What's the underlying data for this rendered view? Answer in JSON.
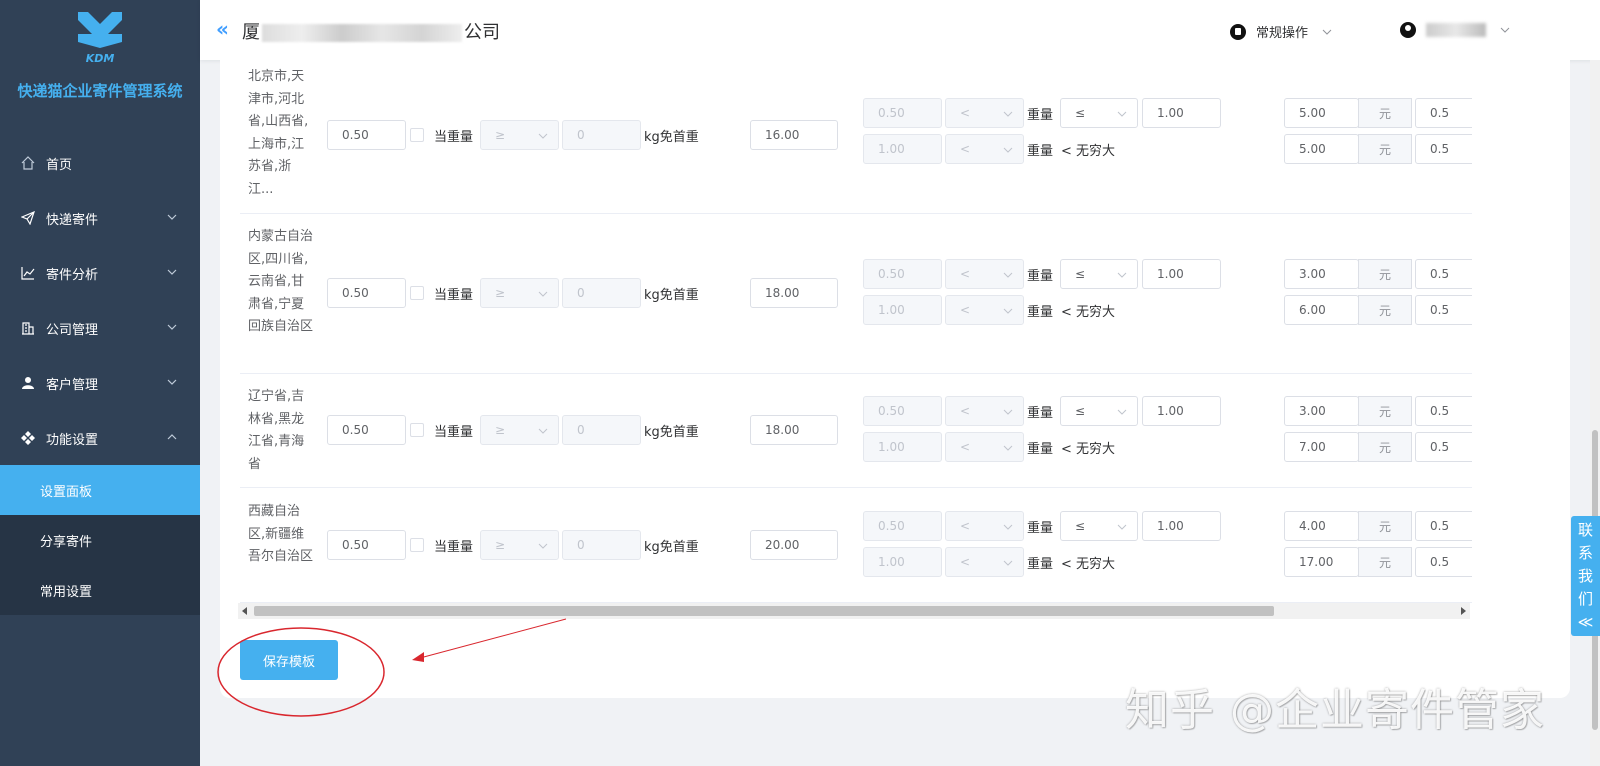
{
  "app": {
    "logo_text": "KDM",
    "title": "快递猫企业寄件管理系统"
  },
  "sidebar": {
    "items": [
      {
        "label": "首页",
        "icon": "home-icon",
        "expandable": false
      },
      {
        "label": "快递寄件",
        "icon": "paper-plane-icon",
        "expandable": true
      },
      {
        "label": "寄件分析",
        "icon": "line-chart-icon",
        "expandable": true
      },
      {
        "label": "公司管理",
        "icon": "building-icon",
        "expandable": true
      },
      {
        "label": "客户管理",
        "icon": "user-icon",
        "expandable": true
      },
      {
        "label": "功能设置",
        "icon": "diamond-icon",
        "expandable": true,
        "expanded": true
      }
    ],
    "subitems": [
      {
        "label": "设置面板",
        "active": true
      },
      {
        "label": "分享寄件",
        "active": false
      },
      {
        "label": "常用设置",
        "active": false
      }
    ]
  },
  "header": {
    "company_prefix": "厦",
    "company_suffix": "公司",
    "ops_label": "常规操作"
  },
  "table": {
    "labels": {
      "when_weight": "当重量",
      "kg_free": "kg免首重",
      "weight": "重量",
      "lt_infinite": "< 无穷大",
      "yuan": "元"
    },
    "rows": [
      {
        "region": "北京市,天津市,河北省,山西省,上海市,江苏省,浙江...",
        "first_weight": "0.50",
        "op": "≥",
        "free_weight": "0",
        "first_price": "16.00",
        "tiers": [
          {
            "from": "0.50",
            "cmp": "<",
            "op2": "≤",
            "to": "1.00",
            "price": "5.00",
            "step": "0.5"
          },
          {
            "from": "1.00",
            "cmp": "<",
            "price": "5.00",
            "step": "0.5"
          }
        ]
      },
      {
        "region": "内蒙古自治区,四川省,云南省,甘肃省,宁夏回族自治区",
        "first_weight": "0.50",
        "op": "≥",
        "free_weight": "0",
        "first_price": "18.00",
        "tiers": [
          {
            "from": "0.50",
            "cmp": "<",
            "op2": "≤",
            "to": "1.00",
            "price": "3.00",
            "step": "0.5"
          },
          {
            "from": "1.00",
            "cmp": "<",
            "price": "6.00",
            "step": "0.5"
          }
        ]
      },
      {
        "region": "辽宁省,吉林省,黑龙江省,青海省",
        "first_weight": "0.50",
        "op": "≥",
        "free_weight": "0",
        "first_price": "18.00",
        "tiers": [
          {
            "from": "0.50",
            "cmp": "<",
            "op2": "≤",
            "to": "1.00",
            "price": "3.00",
            "step": "0.5"
          },
          {
            "from": "1.00",
            "cmp": "<",
            "price": "7.00",
            "step": "0.5"
          }
        ]
      },
      {
        "region": "西藏自治区,新疆维吾尔自治区",
        "first_weight": "0.50",
        "op": "≥",
        "free_weight": "0",
        "first_price": "20.00",
        "tiers": [
          {
            "from": "0.50",
            "cmp": "<",
            "op2": "≤",
            "to": "1.00",
            "price": "4.00",
            "step": "0.5"
          },
          {
            "from": "1.00",
            "cmp": "<",
            "price": "17.00",
            "step": "0.5"
          }
        ]
      }
    ]
  },
  "save_button": "保存模板",
  "contact": [
    "联",
    "系",
    "我",
    "们",
    "≪"
  ],
  "watermark": "知乎 @企业寄件管家",
  "colors": {
    "sidebar_bg": "#304156",
    "accent": "#45b0ef",
    "annotation": "#d9272e"
  }
}
